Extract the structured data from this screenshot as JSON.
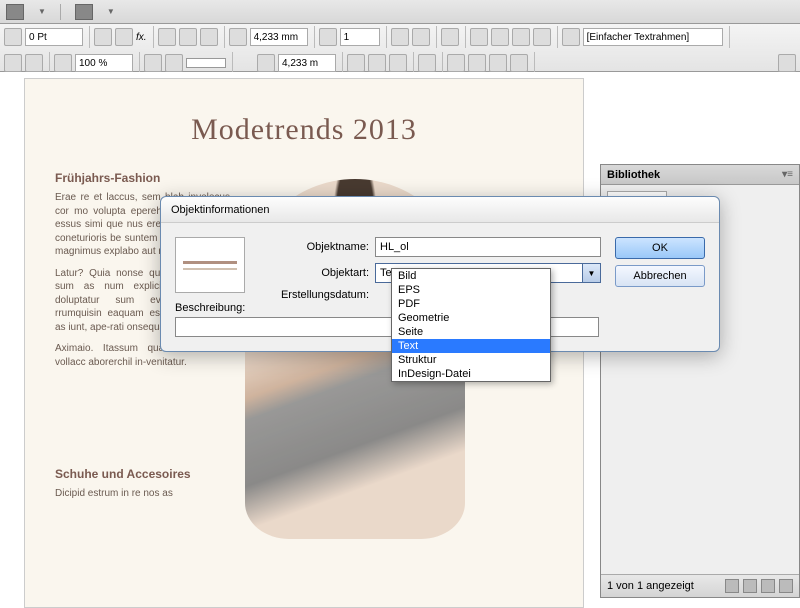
{
  "toolbar": {
    "stroke_pt": "0 Pt",
    "zoom": "100 %",
    "dim1": "4,233 mm",
    "dim2": "4,233 m",
    "count": "1",
    "frame_select": "[Einfacher Textrahmen]"
  },
  "document": {
    "title": "Modetrends 2013",
    "h1": "Frühjahrs-Fashion",
    "p1": "Erae re et laccus, sem blab invelecus cor mo volupta eperehenimi aecerum essus simi que nus ere, sam ad ment, coneturioris be suntem hiciend elisit as magnimus explabo aut rae laccus.",
    "p2": "Latur? Quia nonse quiam, omnistius, sum as num explici endae atius doluptatur sum evelia venimpe rrumquisin eaquam es alissit atquam as iunt, ape-rati onsequatum vel.",
    "p3": "Aximaio. Itassum quam vo-lum et vollacc aborerchil in-venitatur.",
    "h2": "Schuhe und Accesoires",
    "p4": "Dicipid estrum in re nos as"
  },
  "panel": {
    "tab": "Bibliothek",
    "status": "1 von 1 angezeigt"
  },
  "dialog": {
    "title": "Objektinformationen",
    "lbl_name": "Objektname:",
    "val_name": "HL_ol",
    "lbl_type": "Objektart:",
    "val_type": "Text",
    "lbl_date": "Erstellungsdatum:",
    "lbl_desc": "Beschreibung:",
    "btn_ok": "OK",
    "btn_cancel": "Abbrechen"
  },
  "dropdown": {
    "items": [
      "Bild",
      "EPS",
      "PDF",
      "Geometrie",
      "Seite",
      "Text",
      "Struktur",
      "InDesign-Datei"
    ],
    "selected": "Text"
  }
}
